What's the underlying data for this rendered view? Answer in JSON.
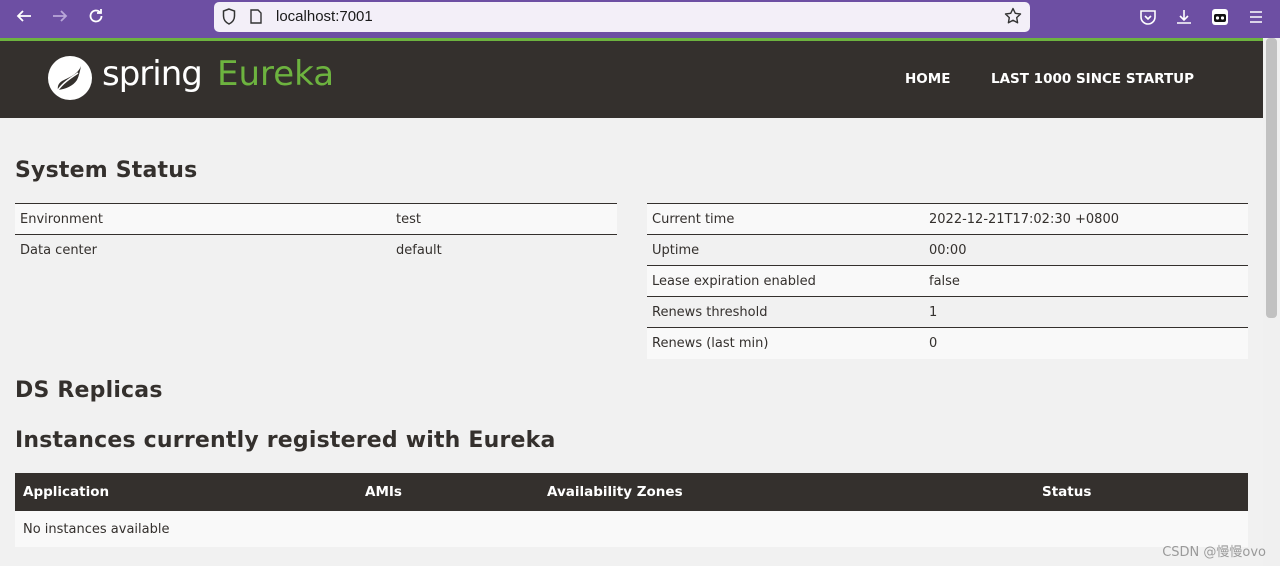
{
  "browser": {
    "url": "localhost:7001",
    "icons": [
      "back-arrow-icon",
      "forward-arrow-icon",
      "reload-icon",
      "shield-icon",
      "page-icon",
      "bookmark-star-icon",
      "pocket-icon",
      "download-icon",
      "extension-icon",
      "menu-icon"
    ]
  },
  "navbar": {
    "brand_spring": "spring",
    "brand_eureka": "Eureka",
    "home": "HOME",
    "last1000": "LAST 1000 SINCE STARTUP",
    "accent": "#6db33f",
    "background": "#34302d"
  },
  "system_status": {
    "title": "System Status",
    "left": [
      {
        "label": "Environment",
        "value": "test"
      },
      {
        "label": "Data center",
        "value": "default"
      }
    ],
    "right": [
      {
        "label": "Current time",
        "value": "2022-12-21T17:02:30 +0800"
      },
      {
        "label": "Uptime",
        "value": "00:00"
      },
      {
        "label": "Lease expiration enabled",
        "value": "false"
      },
      {
        "label": "Renews threshold",
        "value": "1"
      },
      {
        "label": "Renews (last min)",
        "value": "0"
      }
    ]
  },
  "ds_replicas": {
    "title": "DS Replicas"
  },
  "instances": {
    "title": "Instances currently registered with Eureka",
    "columns": [
      "Application",
      "AMIs",
      "Availability Zones",
      "Status"
    ],
    "empty": "No instances available"
  },
  "watermark": "CSDN @慢慢ovo"
}
